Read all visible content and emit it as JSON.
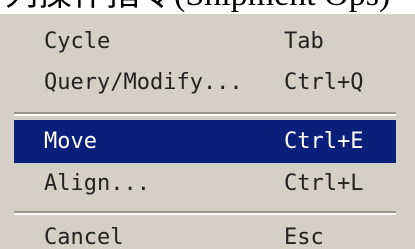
{
  "caption": "列操作指令(Shipment Ops)",
  "menu": {
    "items": [
      {
        "label": "Cycle",
        "shortcut": "Tab"
      },
      {
        "label": "Query/Modify...",
        "shortcut": "Ctrl+Q"
      },
      {
        "label": "Move",
        "shortcut": "Ctrl+E",
        "selected": true
      },
      {
        "label": "Align...",
        "shortcut": "Ctrl+L"
      },
      {
        "label": "Cancel",
        "shortcut": "Esc"
      }
    ]
  },
  "colors": {
    "menu_background": "#d4d0c8",
    "selection_background": "#0a1f7a",
    "selection_text": "#ffffff"
  }
}
